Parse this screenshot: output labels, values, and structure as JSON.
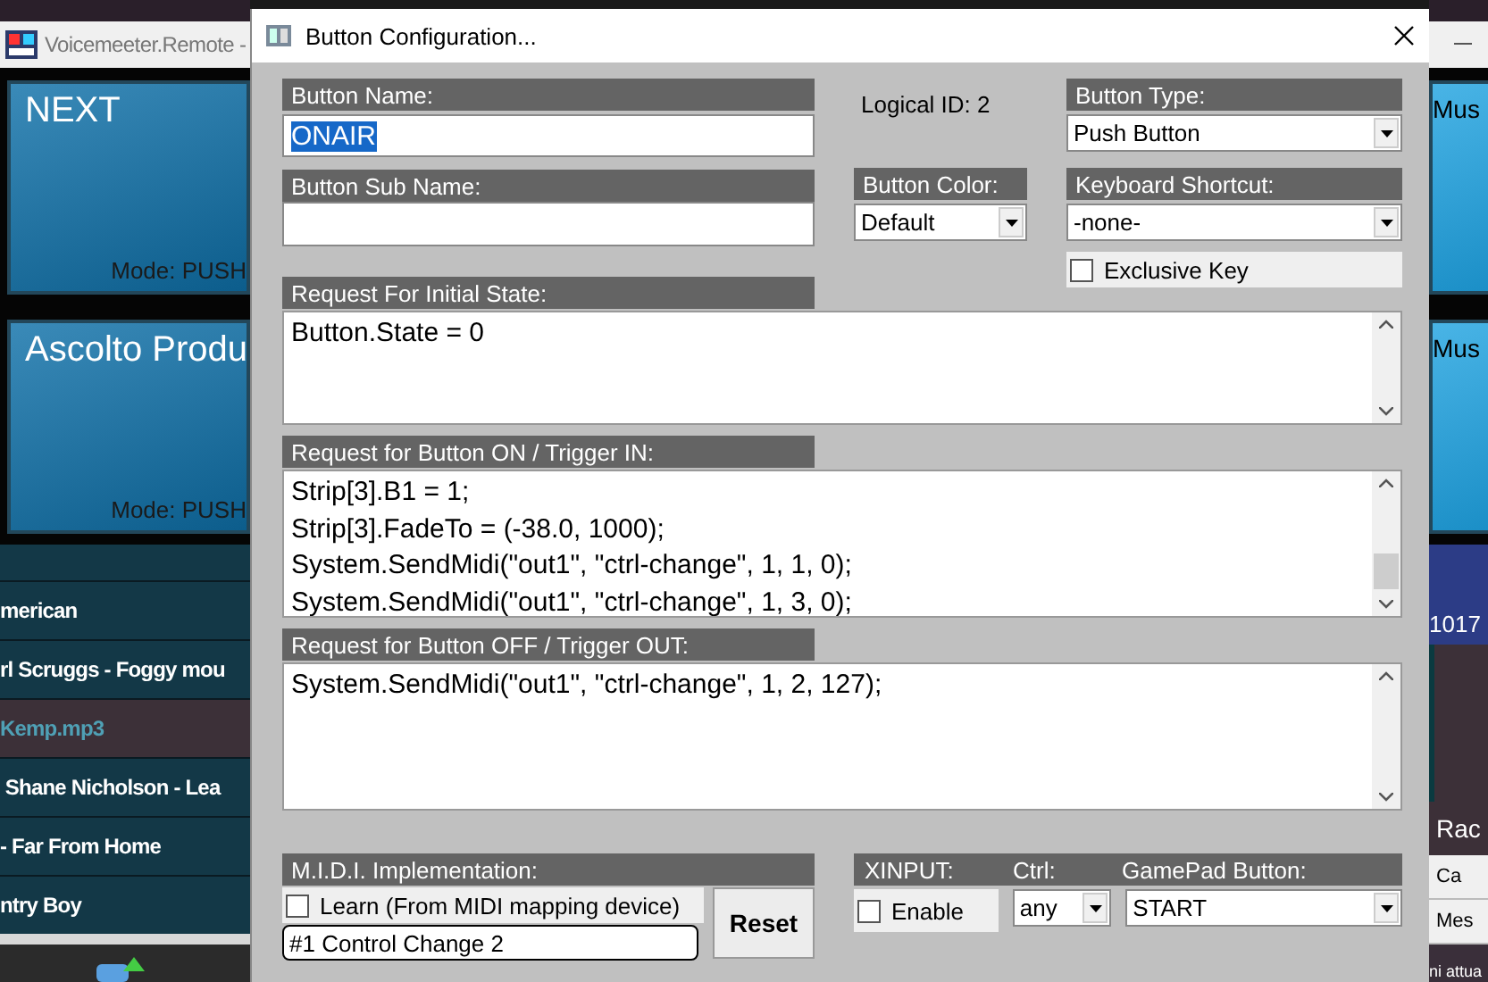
{
  "background_left": {
    "window_title": "Voicemeeter.Remote -",
    "buttons": [
      {
        "name": "NEXT",
        "mode": "Mode: PUSH"
      },
      {
        "name": "Ascolto Produ",
        "mode": "Mode: PUSH"
      }
    ],
    "playlist": [
      {
        "title": "merican",
        "selected": false
      },
      {
        "title": "rl Scruggs - Foggy mou",
        "selected": false
      },
      {
        "title": "Kemp.mp3",
        "selected": true
      },
      {
        "title": " Shane Nicholson - Lea",
        "selected": false
      },
      {
        "title": "- Far From Home",
        "selected": false
      },
      {
        "title": "ntry Boy",
        "selected": false
      }
    ]
  },
  "dialog": {
    "title": "Button Configuration...",
    "button_name": {
      "label": "Button Name:",
      "value": "ONAIR"
    },
    "button_sub_name": {
      "label": "Button Sub Name:"
    },
    "logical_id": "Logical ID: 2",
    "button_type": {
      "label": "Button Type:",
      "value": "Push Button"
    },
    "button_color": {
      "label": "Button Color:",
      "value": "Default"
    },
    "keyboard_shortcut": {
      "label": "Keyboard Shortcut:",
      "value": "-none-"
    },
    "exclusive_key": {
      "label": "Exclusive Key",
      "checked": false
    },
    "scripts": [
      {
        "label": "Request For Initial State:",
        "lines": [
          "Button.State = 0"
        ],
        "thumb": false
      },
      {
        "label": "Request for Button ON / Trigger IN:",
        "lines": [
          "Strip[3].B1 = 1;",
          "Strip[3].FadeTo = (-38.0, 1000);",
          "System.SendMidi(\"out1\", \"ctrl-change\", 1, 1, 0);",
          "System.SendMidi(\"out1\", \"ctrl-change\", 1, 3, 0);"
        ],
        "thumb": true
      },
      {
        "label": "Request for Button OFF / Trigger OUT:",
        "lines": [
          "System.SendMidi(\"out1\", \"ctrl-change\", 1, 2, 127);"
        ],
        "thumb": false
      }
    ],
    "midi": {
      "label": "M.I.D.I. Implementation:",
      "learn": {
        "label": "Learn (From MIDI mapping device)",
        "checked": false
      },
      "mapping": "#1 Control Change 2",
      "reset": "Reset"
    },
    "xinput": {
      "label": "XINPUT:",
      "ctrl_label": "Ctrl:",
      "gamepad_label": "GamePad Button:",
      "enable": {
        "label": "Enable",
        "checked": false
      },
      "ctrl": "any",
      "gamepad_button": "START"
    }
  },
  "background_right": {
    "buttons": [
      {
        "name": "Mus"
      },
      {
        "name": "Mus"
      }
    ],
    "counter": "1017",
    "heading": "Rac",
    "tabs": [
      "Ca",
      "Mes"
    ],
    "status": "ni attua"
  }
}
